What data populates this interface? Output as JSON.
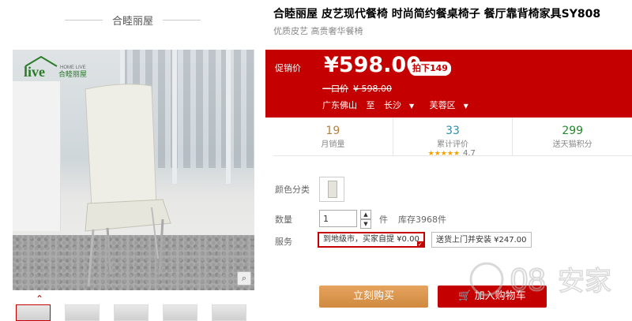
{
  "shop": {
    "name": "合睦丽屋"
  },
  "gallery": {
    "logo_big": "live",
    "logo_small": "HOME LIVE",
    "logo_cn": "合睦丽屋",
    "zoom_icon": "magnifier-icon",
    "thumb_count": 5
  },
  "product": {
    "title": "合睦丽屋 皮艺现代餐椅 时尚简约餐桌椅子 餐厅靠背椅家具SY808",
    "subtitle": "优质皮艺 高贵奢华餐椅"
  },
  "price": {
    "label": "促销价",
    "value": "¥598.00",
    "badge": "拍下149",
    "orig_label": "一口价",
    "orig_value": "¥ 598.00"
  },
  "shipping": {
    "from": "广东佛山",
    "to_word": "至",
    "city": "长沙",
    "district": "芙蓉区"
  },
  "stats": [
    {
      "value": "19",
      "label": "月销量"
    },
    {
      "value": "33",
      "label": "累计评价",
      "rating": "4.7"
    },
    {
      "value": "299",
      "label": "送天猫积分"
    }
  ],
  "options": {
    "color_label": "颜色分类",
    "qty_label": "数量",
    "qty_value": "1",
    "unit": "件",
    "stock": "库存3968件",
    "service_label": "服务",
    "services": [
      "到地级市，买家自提 ¥0.00",
      "送货上门并安装 ¥247.00"
    ]
  },
  "buttons": {
    "buy": "立刻购买",
    "cart": "加入购物车"
  },
  "watermark": {
    "text": "08",
    "cn": "安家"
  },
  "colors": {
    "accent": "#c40000",
    "buy": "#d9964a"
  }
}
